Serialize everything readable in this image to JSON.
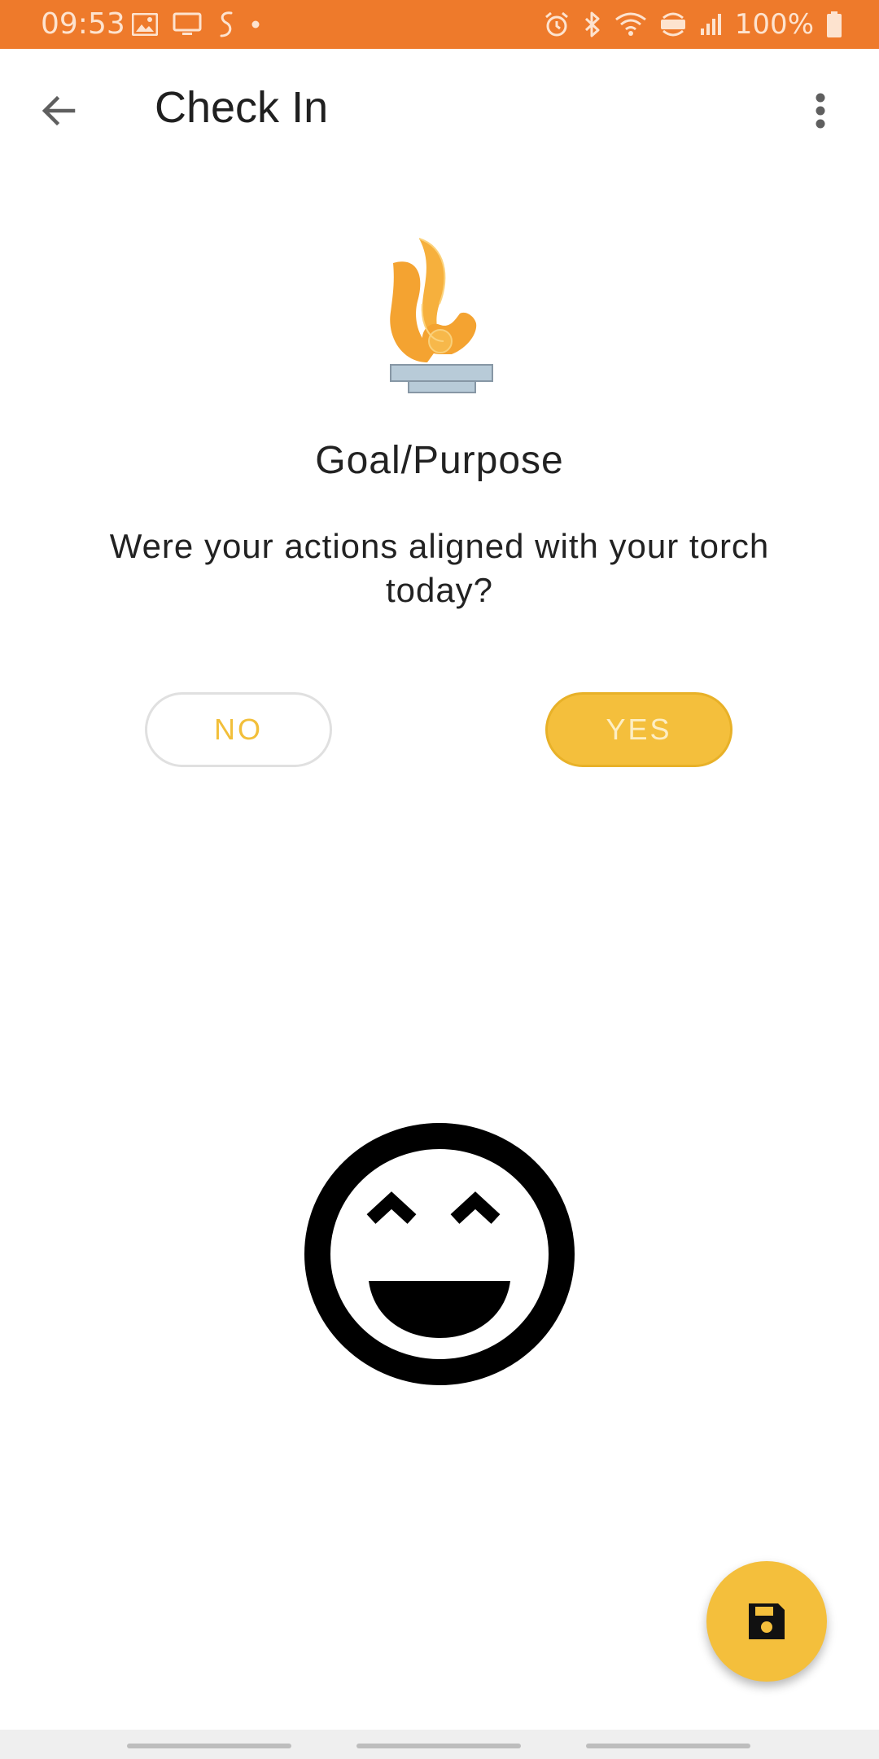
{
  "status_bar": {
    "time": "09:53",
    "battery_percent": "100%",
    "left_icons": [
      "gallery-icon",
      "cast-icon",
      "s-health-icon",
      "dot-icon"
    ],
    "right_icons": [
      "alarm-icon",
      "bluetooth-icon",
      "wifi-icon",
      "volte-icon",
      "signal-icon",
      "battery-icon"
    ],
    "color": "#ee7a2b"
  },
  "app_bar": {
    "title": "Check In",
    "back_icon": "arrow-back-icon",
    "menu_icon": "more-vert-icon"
  },
  "checkin": {
    "illustration": "torch-icon",
    "category": "Goal/Purpose",
    "question": "Were your actions aligned with your torch today?",
    "no_label": "NO",
    "yes_label": "YES",
    "selected": "YES",
    "mood_icon": "laughing-face-icon"
  },
  "fab": {
    "icon": "save-icon"
  },
  "colors": {
    "accent": "#f4bf3c",
    "status_bar": "#ee7a2b",
    "text": "#222222"
  }
}
